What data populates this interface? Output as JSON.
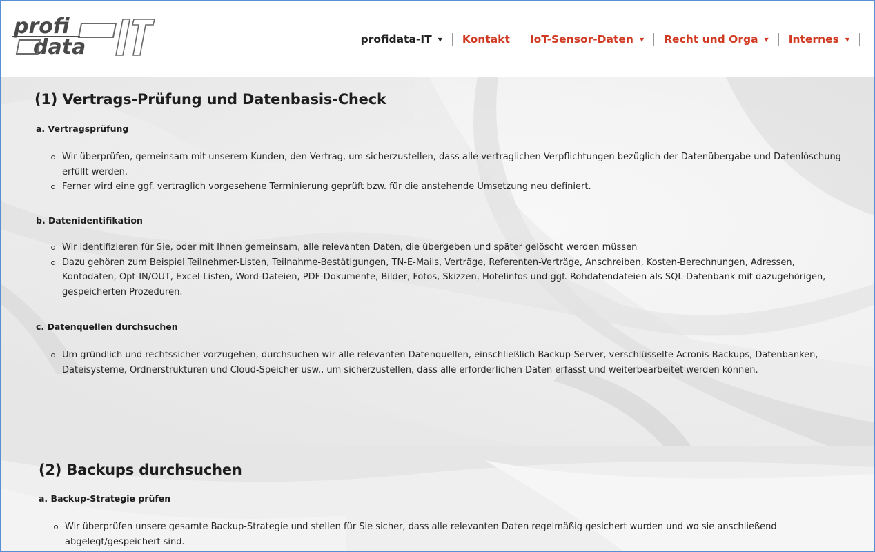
{
  "header": {
    "logo_text_top": "profi",
    "logo_text_bottom": "data",
    "logo_mark": "IT",
    "nav": [
      {
        "label": "profidata-IT",
        "has_dropdown": true,
        "color": "#222222"
      },
      {
        "label": "Kontakt",
        "has_dropdown": false,
        "color": "#d13a22"
      },
      {
        "label": "IoT-Sensor-Daten",
        "has_dropdown": true,
        "color": "#d13a22"
      },
      {
        "label": "Recht und Orga",
        "has_dropdown": true,
        "color": "#d13a22"
      },
      {
        "label": "Internes",
        "has_dropdown": true,
        "color": "#d13a22"
      }
    ]
  },
  "section1": {
    "title": "(1) Vertrags-Prüfung und Datenbasis-Check",
    "a": {
      "heading": "a. Vertragsprüfung",
      "items": [
        "Wir überprüfen, gemeinsam mit unserem Kunden, den Vertrag, um sicherzustellen, dass alle vertraglichen Verpflichtungen bezüglich der Datenübergabe und Datenlöschung erfüllt werden.",
        "Ferner wird eine ggf. vertraglich vorgesehene Terminierung geprüft bzw. für die anstehende Umsetzung neu definiert."
      ]
    },
    "b": {
      "heading": "b. Datenidentifikation",
      "items": [
        "Wir identifizieren für Sie, oder mit Ihnen gemeinsam, alle relevanten Daten, die übergeben und später gelöscht werden müssen",
        "Dazu gehören zum Beispiel Teilnehmer-Listen, Teilnahme-Bestätigungen, TN-E-Mails, Verträge, Referenten-Verträge, Anschreiben, Kosten-Berechnungen, Adressen, Kontodaten, Opt-IN/OUT, Excel-Listen, Word-Dateien, PDF-Dokumente, Bilder, Fotos, Skizzen, Hotelinfos und ggf. Rohdatendateien als SQL-Datenbank mit dazugehörigen, gespeicherten Prozeduren."
      ]
    },
    "c": {
      "heading": "c. Datenquellen durchsuchen",
      "items": [
        "Um gründlich und rechtssicher vorzugehen, durchsuchen wir alle relevanten Datenquellen, einschließlich Backup-Server, verschlüsselte Acronis-Backups, Datenbanken, Dateisysteme, Ordnerstrukturen und Cloud-Speicher usw., um sicherzustellen, dass alle erforderlichen Daten erfasst und weiterbearbeitet werden können."
      ]
    }
  },
  "section2": {
    "title": "(2) Backups durchsuchen",
    "a": {
      "heading": "a. Backup-Strategie prüfen",
      "items": [
        "Wir überprüfen unsere gesamte Backup-Strategie und stellen für Sie sicher, dass alle relevanten Daten regelmäßig gesichert wurden und wo sie anschließend abgelegt/gespeichert sind."
      ]
    }
  },
  "colors": {
    "accent_red": "#d13a22",
    "text_dark": "#1e1e1e",
    "frame_border": "#5b8fd4"
  }
}
